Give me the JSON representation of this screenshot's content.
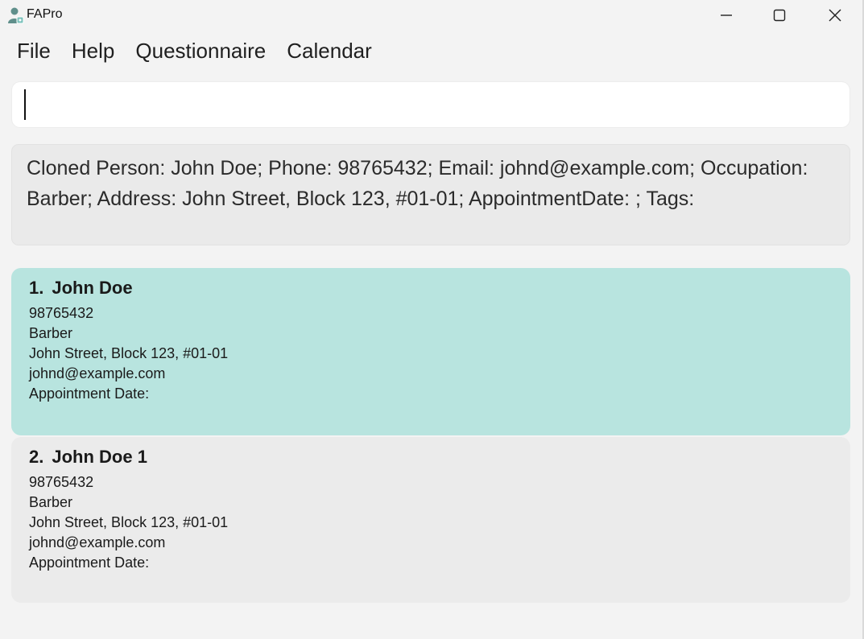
{
  "window": {
    "title": "FAPro",
    "icon": "person-with-badge-icon"
  },
  "menu": {
    "items": [
      "File",
      "Help",
      "Questionnaire",
      "Calendar"
    ]
  },
  "command": {
    "value": "",
    "placeholder": ""
  },
  "result": {
    "text": "Cloned Person: John Doe; Phone: 98765432; Email: johnd@example.com; Occupation: Barber; Address: John Street, Block 123, #01-01; AppointmentDate: ; Tags:"
  },
  "persons": [
    {
      "index": "1.",
      "name": "John Doe",
      "phone": "98765432",
      "occupation": "Barber",
      "address": "John Street, Block 123, #01-01",
      "email": "johnd@example.com",
      "appointment": "Appointment Date:",
      "selected": true
    },
    {
      "index": "2.",
      "name": "John Doe 1",
      "phone": "98765432",
      "occupation": "Barber",
      "address": "John Street, Block 123, #01-01",
      "email": "johnd@example.com",
      "appointment": "Appointment Date:",
      "selected": false
    }
  ],
  "colors": {
    "selected_card": "#b8e4df",
    "card": "#ebebeb",
    "background": "#f3f3f3"
  }
}
